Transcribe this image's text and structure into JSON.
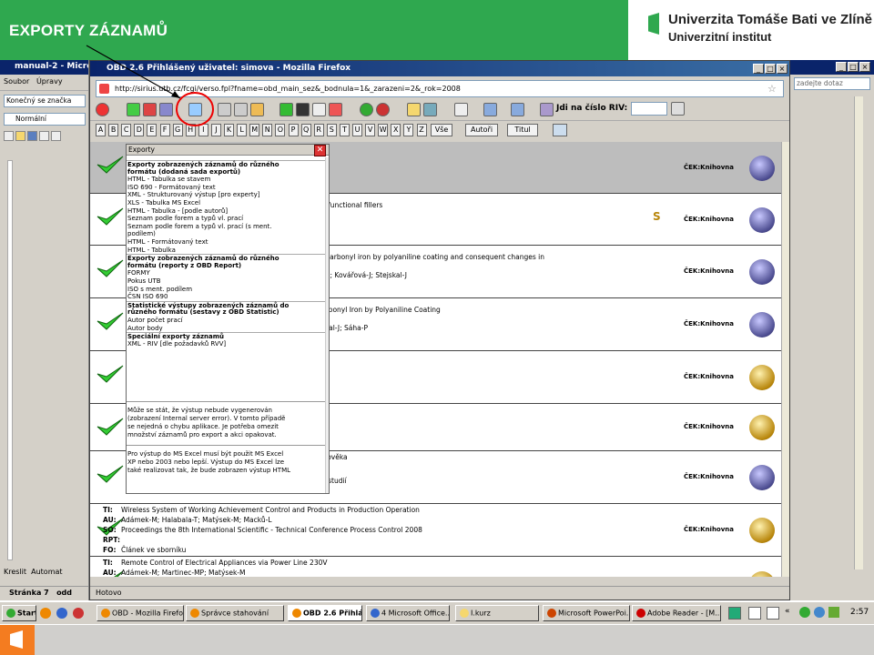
{
  "slide": {
    "title": "EXPORTY ZÁZNAMŮ",
    "university_line1": "Univerzita Tomáše Bati ve Zlíně",
    "university_line2": "Univerzitní institut"
  },
  "word": {
    "title": "manual-2 - Microsoft",
    "menu": [
      "Soubor",
      "Úpravy"
    ],
    "style_label": "Konečný se značka",
    "normal_style": "Normální",
    "page_label": "Stránka 7",
    "odd_label": "odd",
    "draw_label": "Kreslit",
    "auto_label": "Automat"
  },
  "right_window": {
    "ask_placeholder": "zadejte dotaz"
  },
  "firefox": {
    "title": "OBD 2.6 Přihlášený uživatel: simova - Mozilla Firefox",
    "url": "http://sirius.utb.cz/fcgi/verso.fpl?fname=obd_main_sez&_bodnula=1&_zarazeni=2&_rok=2008",
    "riv_label": "Jdi na číslo RIV:",
    "letters": [
      "A",
      "B",
      "C",
      "D",
      "E",
      "F",
      "G",
      "H",
      "I",
      "J",
      "K",
      "L",
      "M",
      "N",
      "O",
      "P",
      "Q",
      "R",
      "S",
      "T",
      "U",
      "V",
      "W",
      "X",
      "Y",
      "Z"
    ],
    "btn_all": "Vše",
    "btn_authors": "Autoři",
    "btn_title": "Titul",
    "status": "Hotovo"
  },
  "records": [
    {
      "cek": "ČEK:Knihovna",
      "badge": "blue",
      "lines": []
    },
    {
      "cek": "ČEK:Knihovna",
      "badge": "blue",
      "lines": [
        "h functional fillers"
      ],
      "mark": "S"
    },
    {
      "cek": "ČEK:Knihovna",
      "badge": "blue",
      "lines": [
        "f carbonyl iron by polyaniline coating and consequent changes in",
        "a-I; Kovářová-J; Stejskal-J"
      ]
    },
    {
      "cek": "ČEK:Knihovna",
      "badge": "blue",
      "lines": [
        "arbonyl Iron by Polyaniline Coating",
        "skal-J; Sáha-P"
      ]
    },
    {
      "cek": "ČEK:Knihovna",
      "badge": "gold",
      "lines": []
    },
    {
      "cek": "ČEK:Knihovna",
      "badge": "gold",
      "lines": []
    },
    {
      "cek": "ČEK:Knihovna",
      "badge": "blue",
      "lines": [
        "člověka",
        "h studií"
      ]
    },
    {
      "cek": "ČEK:Knihovna",
      "badge": "gold",
      "lines": []
    },
    {
      "cek": "ČEK:Knihovna",
      "badge": "gold",
      "lines": []
    }
  ],
  "record_full_a": {
    "ti_label": "TI:",
    "ti": "Wireless System of Working Achievement Control and Products in Production Operation",
    "au_label": "AU:",
    "au": "Adámek-M; Halabala-T; Matýsek-M; Macků-L",
    "so_label": "SO:",
    "so": "Proceedings the 8th International Scientific - Technical Conference Process Control 2008",
    "rpt_label": "RPT:",
    "fo_label": "FO:",
    "fo": "Článek ve sborníku"
  },
  "record_full_b": {
    "ti_label": "TI:",
    "ti": "Remote Control of Electrical Appliances via Power Line 230V",
    "au_label": "AU:",
    "au": "Adámek-M; Martinec-MP; Matýsek-M",
    "so_label": "SO:",
    "so": "Proceedings the 8th International Scientific - Technical Conference Process Control 2008"
  },
  "exports": {
    "header": "Exporty",
    "close": "✕",
    "items": [
      {
        "t": "Exporty zobrazených záznamů do různého",
        "h": true
      },
      {
        "t": "formátu (dodaná sada exportů)",
        "h": true,
        "c": true
      },
      {
        "t": "HTML - Tabulka se stavem"
      },
      {
        "t": "ISO 690 - Formátovaný text"
      },
      {
        "t": "XML - Strukturovaný výstup [pro experty]"
      },
      {
        "t": "XLS - Tabulka MS Excel"
      },
      {
        "t": "HTML - Tabulka - [podle autorů]"
      },
      {
        "t": "Seznam podle forem a typů vl. prací"
      },
      {
        "t": "Seznam podle forem a typů vl. prací (s ment."
      },
      {
        "t": "podílem)"
      },
      {
        "t": "HTML - Formátovaný text"
      },
      {
        "t": "HTML - Tabulka"
      },
      {
        "t": "Exporty zobrazených záznamů do různého",
        "h": true
      },
      {
        "t": "formátu (reporty z OBD Report)",
        "h": true,
        "c": true
      },
      {
        "t": "FORMY"
      },
      {
        "t": "Pokus UTB"
      },
      {
        "t": "ISO s ment. podílem"
      },
      {
        "t": "ČSN ISO 690"
      },
      {
        "t": "Statistické výstupy zobrazených záznamů do",
        "h": true
      },
      {
        "t": "různého formátu (sestavy z OBD Statistic)",
        "h": true,
        "c": true
      },
      {
        "t": "Autor počet prací"
      },
      {
        "t": "Autor body"
      },
      {
        "t": "Speciální exporty záznamů",
        "h": true
      },
      {
        "t": "XML - RIV [dle požadavků RVV]"
      }
    ],
    "note1": [
      "Může se stát, že výstup nebude vygenerován",
      "(zobrazení Internal server error). V tomto případě",
      "se nejedná o chybu aplikace. Je potřeba omezit",
      "množství záznamů pro export a akci opakovat."
    ],
    "note2": [
      "Pro výstup do MS Excel musí být použit MS Excel",
      "XP nebo 2003 nebo lepší. Výstup do MS Excel lze",
      "také realizovat tak, že bude zobrazen výstup HTML"
    ]
  },
  "taskbar": {
    "start": "Start",
    "tasks": [
      "OBD - Mozilla Firefox",
      "Správce stahování",
      "OBD 2.6 Přihlá...",
      "4 Microsoft Office...",
      "I.kurz",
      "Microsoft PowerPoi...",
      "Adobe Reader - [M..."
    ],
    "clock": "2:57"
  }
}
